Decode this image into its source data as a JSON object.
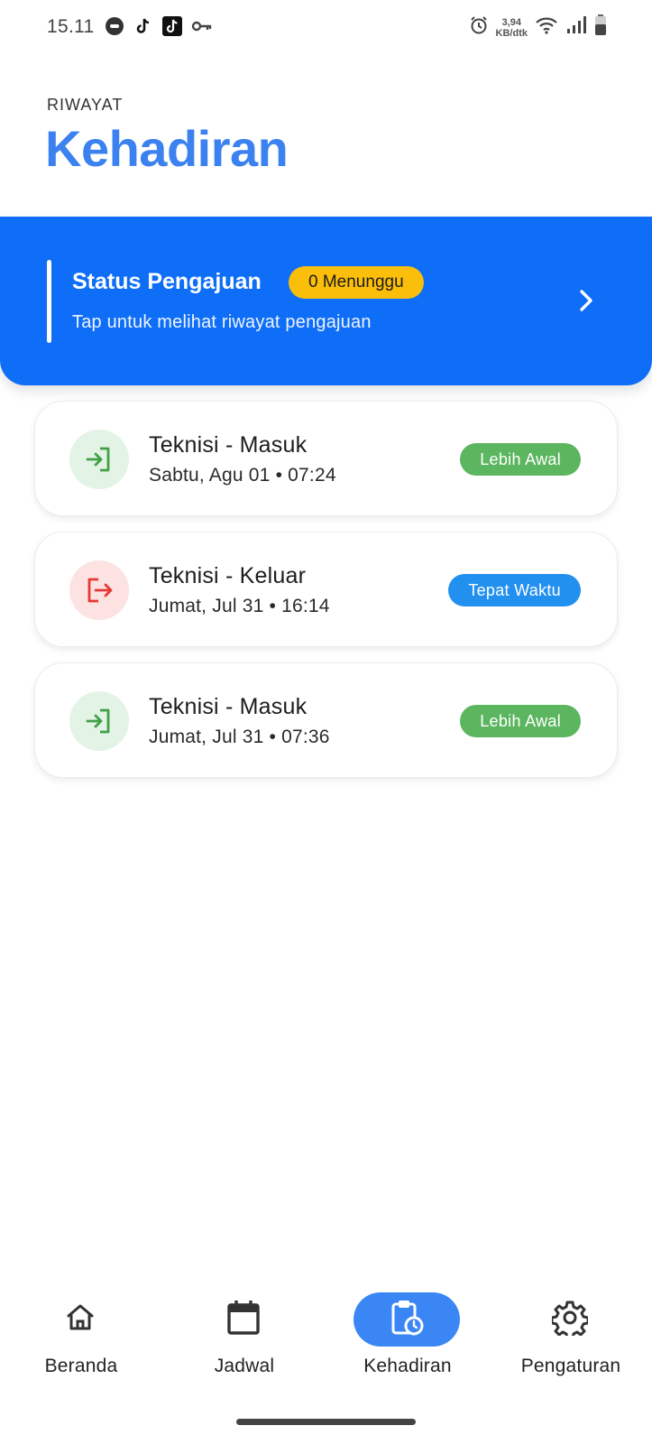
{
  "status_bar": {
    "time": "15.11",
    "speed_value": "3,94",
    "speed_unit": "KB/dtk",
    "icons_left": [
      "messenger-icon",
      "tiktok-icon",
      "tiktok-icon",
      "vpn-key-icon"
    ],
    "icons_right": [
      "alarm-icon",
      "wifi-icon",
      "signal-icon",
      "battery-icon"
    ]
  },
  "header": {
    "subtitle": "RIWAYAT",
    "title": "Kehadiran"
  },
  "banner": {
    "title": "Status Pengajuan",
    "badge": "0 Menunggu",
    "description": "Tap untuk melihat riwayat pengajuan"
  },
  "records": [
    {
      "type": "in",
      "title": "Teknisi - Masuk",
      "datetime": "Sabtu, Agu 01 • 07:24",
      "status": "Lebih Awal",
      "status_color": "#5cb55f"
    },
    {
      "type": "out",
      "title": "Teknisi - Keluar",
      "datetime": "Jumat, Jul 31 • 16:14",
      "status": "Tepat Waktu",
      "status_color": "#2290ee"
    },
    {
      "type": "in",
      "title": "Teknisi - Masuk",
      "datetime": "Jumat, Jul 31 • 07:36",
      "status": "Lebih Awal",
      "status_color": "#5cb55f"
    }
  ],
  "nav": {
    "items": [
      {
        "label": "Beranda",
        "icon": "home-icon"
      },
      {
        "label": "Jadwal",
        "icon": "calendar-icon"
      },
      {
        "label": "Kehadiran",
        "icon": "clipboard-clock-icon",
        "active": true
      },
      {
        "label": "Pengaturan",
        "icon": "gear-icon"
      }
    ]
  },
  "colors": {
    "accent": "#3b82f0",
    "banner": "#0f6ef7",
    "badge_pending": "#fbbf0b",
    "icon_in": "#43a047",
    "icon_out": "#e53935"
  }
}
